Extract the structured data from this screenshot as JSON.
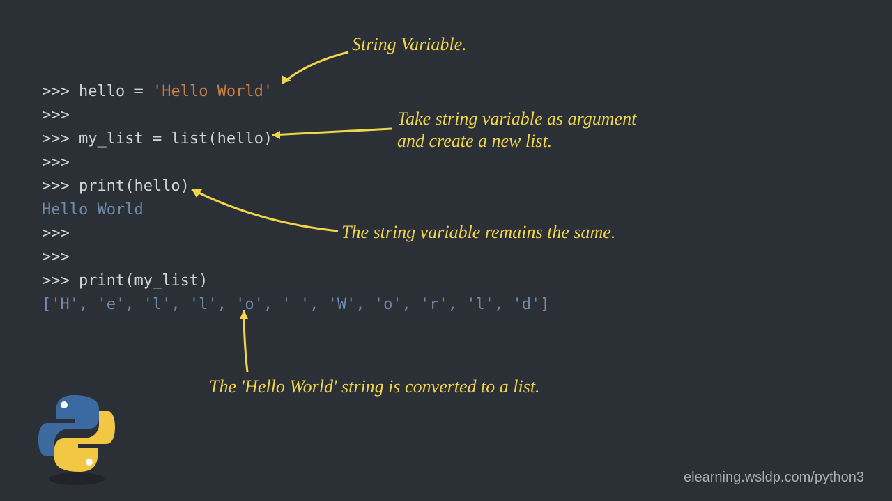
{
  "code": {
    "l1_prompt": ">>> ",
    "l1_var": "hello ",
    "l1_op": "= ",
    "l1_str": "'Hello World'",
    "l2": ">>>",
    "l3_prompt": ">>> ",
    "l3_rest": "my_list = list(hello)",
    "l4": ">>>",
    "l5_prompt": ">>> ",
    "l5_rest": "print(hello)",
    "l6_out": "Hello World",
    "l7": ">>>",
    "l8": ">>>",
    "l9_prompt": ">>> ",
    "l9_rest": "print(my_list)",
    "l10_out": "['H', 'e', 'l', 'l', 'o', ' ', 'W', 'o', 'r', 'l', 'd']"
  },
  "annotations": {
    "a1": "String Variable.",
    "a2_line1": "Take string variable as argument",
    "a2_line2": "and create a new list.",
    "a3": "The string variable remains the same.",
    "a4": "The 'Hello World' string is converted to a list."
  },
  "footer": "elearning.wsldp.com/python3"
}
